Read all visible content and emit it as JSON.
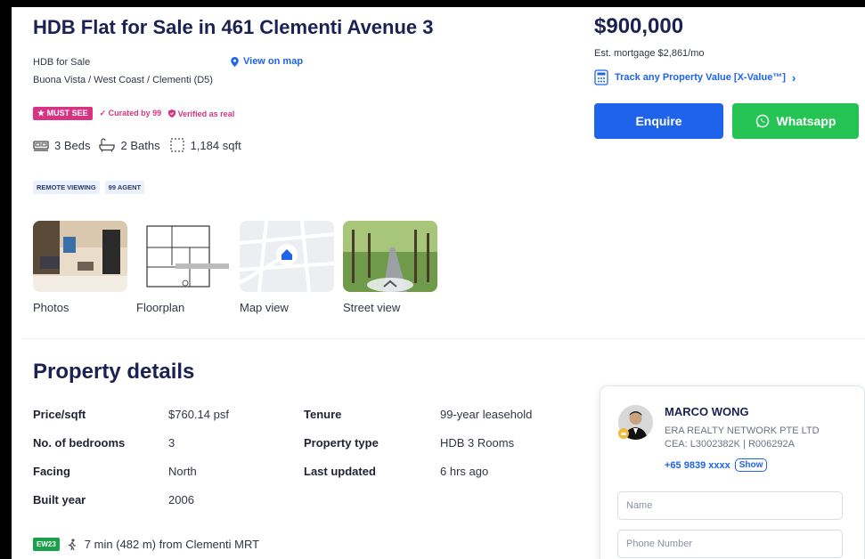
{
  "listing": {
    "title": "HDB Flat for Sale in 461 Clementi Avenue 3",
    "type": "HDB for Sale",
    "location": "Buona Vista / West Coast / Clementi (D5)",
    "view_on_map": "View on map"
  },
  "badges": {
    "must_see": "★ MUST SEE",
    "curated": "✓ Curated by 99",
    "verified": "Verified as real"
  },
  "features": {
    "beds": "3 Beds",
    "baths": "2 Baths",
    "area": "1,184 sqft"
  },
  "tags": [
    "REMOTE VIEWING",
    "99 AGENT"
  ],
  "media": [
    {
      "label": "Photos",
      "icon": "photo"
    },
    {
      "label": "Floorplan",
      "icon": "floorplan"
    },
    {
      "label": "Map view",
      "icon": "map"
    },
    {
      "label": "Street view",
      "icon": "street"
    }
  ],
  "pricing": {
    "price": "$900,000",
    "mortgage": "Est. mortgage $2,861/mo",
    "xvalue": "Track any Property Value [X-Value™]"
  },
  "actions": {
    "enquire": "Enquire",
    "whatsapp": "Whatsapp"
  },
  "details": {
    "heading": "Property details",
    "rows": [
      {
        "key": "Price/sqft",
        "value": "$760.14 psf"
      },
      {
        "key": "No. of bedrooms",
        "value": "3"
      },
      {
        "key": "Facing",
        "value": "North"
      },
      {
        "key": "Built year",
        "value": "2006"
      },
      {
        "key": "Tenure",
        "value": "99-year leasehold"
      },
      {
        "key": "Property type",
        "value": "HDB 3 Rooms"
      },
      {
        "key": "Last updated",
        "value": "6 hrs ago"
      }
    ]
  },
  "mrt": {
    "code": "EW23",
    "text": "7 min (482 m) from Clementi MRT"
  },
  "agent": {
    "name": "MARCO WONG",
    "agency": "ERA REALTY NETWORK PTE LTD",
    "cea": "CEA: L3002382K | R006292A",
    "phone": "+65 9839 xxxx",
    "show": "Show",
    "name_placeholder": "Name",
    "phone_placeholder": "Phone Number"
  },
  "colors": {
    "brand_blue": "#1e63ea",
    "navy": "#1b2152",
    "whatsapp_green": "#25c354",
    "must_see_pink": "#d63384",
    "mrt_green": "#18a149"
  }
}
